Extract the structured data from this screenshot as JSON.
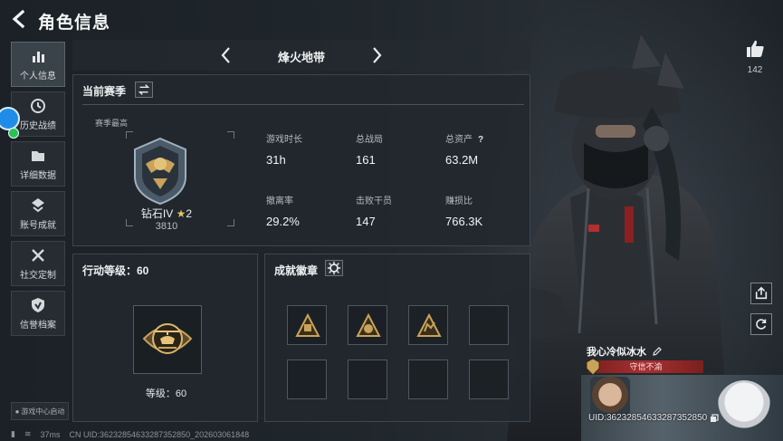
{
  "header": {
    "title": "角色信息"
  },
  "sidebar": {
    "items": [
      {
        "label": "个人信息",
        "icon": "bar-chart-icon",
        "active": true
      },
      {
        "label": "历史战绩",
        "icon": "history-icon",
        "active": false
      },
      {
        "label": "详细数据",
        "icon": "folder-icon",
        "active": false
      },
      {
        "label": "账号成就",
        "icon": "achievement-icon",
        "active": false
      },
      {
        "label": "社交定制",
        "icon": "tools-icon",
        "active": false
      },
      {
        "label": "信誉档案",
        "icon": "shield-icon",
        "active": false
      }
    ],
    "game_center": "游戏中心启动"
  },
  "status_bar": {
    "ping": "37ms",
    "cn_uid": "CN UID:36232854633287352850_202603061848"
  },
  "map": {
    "name": "烽火地带"
  },
  "season": {
    "title": "当前赛季",
    "best_label": "赛季最高",
    "rank_name": "钻石IV",
    "rank_stars": "2",
    "rank_score": "3810",
    "stats": [
      {
        "label": "游戏时长",
        "value": "31h"
      },
      {
        "label": "总战局",
        "value": "161"
      },
      {
        "label": "总资产",
        "value": "63.2M",
        "help": "?"
      },
      {
        "label": "撤离率",
        "value": "29.2%"
      },
      {
        "label": "击败干员",
        "value": "147"
      },
      {
        "label": "赚损比",
        "value": "766.3K"
      }
    ]
  },
  "action_level": {
    "title": "行动等级：60",
    "level_text": "等级：60"
  },
  "achievements": {
    "title": "成就徽章",
    "badges": [
      "tower-badge",
      "ticket-badge",
      "crate-badge",
      "",
      "",
      "",
      "",
      ""
    ]
  },
  "profile": {
    "likes": "142",
    "player_name": "我心冷似冰水",
    "player_title": "守信不渝",
    "uid": "UID:36232854633287352850"
  },
  "colors": {
    "accent_gold": "#c9a35a",
    "title_red": "#a83030",
    "panel_bg": "#22282e"
  }
}
